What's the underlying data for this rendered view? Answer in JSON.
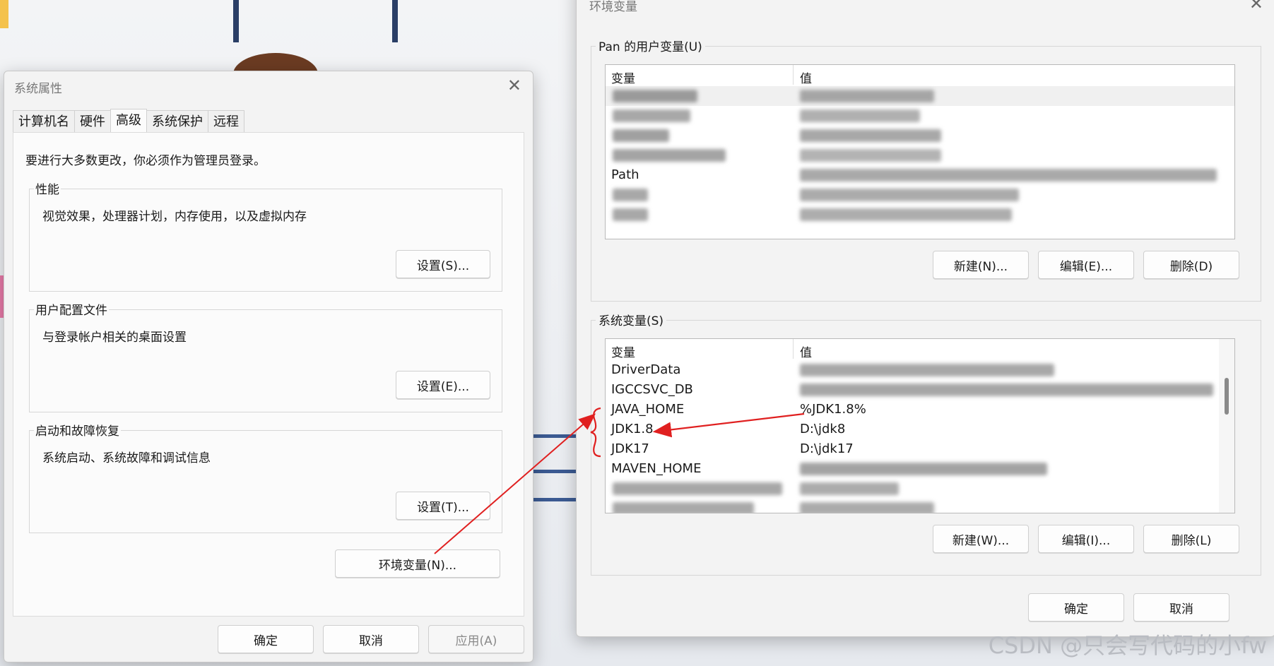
{
  "system_properties": {
    "title": "系统属性",
    "tabs": [
      "计算机名",
      "硬件",
      "高级",
      "系统保护",
      "远程"
    ],
    "active_tab": "高级",
    "admin_note": "要进行大多数更改，你必须作为管理员登录。",
    "performance": {
      "label": "性能",
      "description": "视觉效果，处理器计划，内存使用，以及虚拟内存",
      "button": "设置(S)..."
    },
    "user_profiles": {
      "label": "用户配置文件",
      "description": "与登录帐户相关的桌面设置",
      "button": "设置(E)..."
    },
    "startup_recovery": {
      "label": "启动和故障恢复",
      "description": "系统启动、系统故障和调试信息",
      "button": "设置(T)..."
    },
    "env_button": "环境变量(N)...",
    "ok": "确定",
    "cancel": "取消",
    "apply": "应用(A)"
  },
  "environment_variables": {
    "user_section": {
      "label": "Pan 的用户变量(U)",
      "col_var": "变量",
      "col_val": "值",
      "visible_fragments": [
        "Path"
      ],
      "new": "新建(N)...",
      "edit": "编辑(E)...",
      "delete": "删除(D)"
    },
    "system_section": {
      "label": "系统变量(S)",
      "col_var": "变量",
      "col_val": "值",
      "rows": [
        {
          "name": "DriverData",
          "value": ""
        },
        {
          "name": "IGCCSVC_DB",
          "value": ""
        },
        {
          "name": "JAVA_HOME",
          "value": "%JDK1.8%"
        },
        {
          "name": "JDK1.8",
          "value": "D:\\jdk8"
        },
        {
          "name": "JDK17",
          "value": "D:\\jdk17"
        },
        {
          "name": "MAVEN_HOME",
          "value": ""
        }
      ],
      "new": "新建(W)...",
      "edit": "编辑(I)...",
      "delete": "删除(L)"
    },
    "ok": "确定",
    "cancel": "取消"
  },
  "watermark": "CSDN @只会写代码的小fw",
  "annotation_color": "#e02020"
}
